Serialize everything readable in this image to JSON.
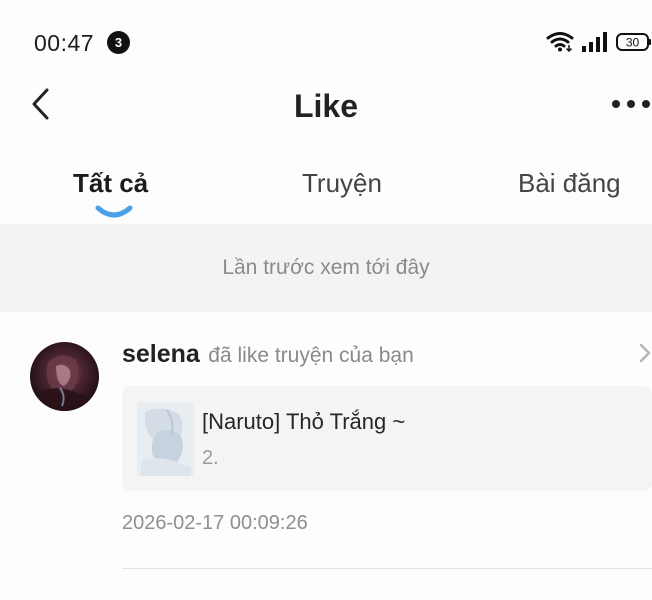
{
  "status_bar": {
    "time": "00:47",
    "notification_count": "3",
    "battery": "30",
    "icons": [
      "wifi-icon",
      "signal-icon",
      "battery-icon"
    ]
  },
  "header": {
    "title": "Like",
    "back_icon": "chevron-left-icon",
    "more_icon": "more-horizontal-icon"
  },
  "tabs": [
    {
      "label": "Tất cả",
      "active": true
    },
    {
      "label": "Truyện",
      "active": false
    },
    {
      "label": "Bài đăng",
      "active": false
    }
  ],
  "banner": {
    "text": "Lần trước xem tới đây"
  },
  "notifications": [
    {
      "user": "selena",
      "action": "đã like truyện của bạn",
      "story": {
        "title": "[Naruto] Thỏ Trắng ~",
        "chapter": "2."
      },
      "time": "2026-02-17 00:09:26"
    }
  ],
  "colors": {
    "accent": "#4a9fe8",
    "background": "#fdfdfd",
    "banner_bg": "#f3f3f3",
    "card_bg": "#f4f4f4",
    "muted_text": "#8a8a8a"
  }
}
